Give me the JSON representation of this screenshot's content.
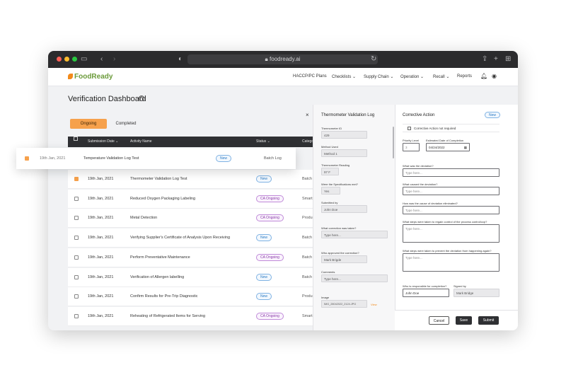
{
  "browser": {
    "url": "foodready.ai"
  },
  "brand": {
    "name": "FoodReady"
  },
  "nav": {
    "items": [
      "HACCP/PC Plans",
      "Checklists ⌄",
      "Supply Chain ⌄",
      "Operation ⌄",
      "Recall ⌄",
      "Reports"
    ]
  },
  "page": {
    "title": "Verification Dashboard",
    "close": "×"
  },
  "tabs": {
    "ongoing": "Ongoing",
    "completed": "Completed"
  },
  "table": {
    "headers": {
      "submission_date": "Submission Date ⌄",
      "activity_name": "Activity Name",
      "status": "Status ⌄",
      "category": "Catego"
    },
    "floating_row": {
      "date": "19th Jan, 2021",
      "activity": "Temperature Validation Log Test",
      "status": "New",
      "category": "Batch Log"
    },
    "rows": [
      {
        "date": "19th Jan, 2021",
        "activity": "Thermometer Validation Log Test",
        "status": "New",
        "category": "Batch"
      },
      {
        "date": "19th Jan, 2021",
        "activity": "Reduced Oxygen Packaging Labeling",
        "status": "CA Ongoing",
        "category": "Smart"
      },
      {
        "date": "19th Jan, 2021",
        "activity": "Metal Detection",
        "status": "CA Ongoing",
        "category": "Produ"
      },
      {
        "date": "19th Jan, 2021",
        "activity": "Verifying Supplier's Certificate of Analysis Upon Receiving",
        "status": "New",
        "category": "Batch"
      },
      {
        "date": "19th Jan, 2021",
        "activity": "Perform Preventative Maintenance",
        "status": "CA Ongoing",
        "category": "Batch"
      },
      {
        "date": "19th Jan, 2021",
        "activity": "Verification of Allergen labelling",
        "status": "New",
        "category": "Batch"
      },
      {
        "date": "19th Jan, 2021",
        "activity": "Confirm Results for Pre-Trip Diagnostic",
        "status": "New",
        "category": "Produ"
      },
      {
        "date": "19th Jan, 2021",
        "activity": "Reheating of Refrigerated Items for Serving",
        "status": "CA Ongoing",
        "category": "Smart"
      }
    ]
  },
  "log_panel": {
    "title": "Thermometer Validation Log",
    "thermometer_id_label": "Thermometer ID",
    "thermometer_id": "429",
    "method_used_label": "Method Used",
    "method_used": "Method 1",
    "reading_label": "Thermometer Reading",
    "reading": "97 F",
    "specs_met_label": "Were the Specifications met?",
    "specs_met": "Yes",
    "submitted_by_label": "Submitted by",
    "submitted_by": "John Doe",
    "correction_label": "What correction was taken?",
    "correction_placeholder": "Type here...",
    "approved_label": "Who approved the correction?",
    "approved_by": "Mark Brigde",
    "comments_label": "Comments",
    "comments_placeholder": "Type here...",
    "image_label": "Image",
    "image_file": "IMG_28042022_2124.JPG",
    "image_link": "View"
  },
  "ca_panel": {
    "title": "Corrective Action",
    "badge": "New",
    "not_required_label": "Corrective Action not required",
    "priority_label": "Priority Level",
    "priority_value": "3",
    "est_date_label": "Estimated Date of Completion",
    "est_date_value": "04/24/2022",
    "q_deviation": "What was the deviation?",
    "q_cause": "What caused the deviation?",
    "q_eliminated": "How was the cause of deviation eliminated?",
    "q_regain": "What steps were taken to regain control of the process control/ccp?",
    "q_prevent": "What steps were taken to prevent the deviation from happening again?",
    "placeholder": "Type here...",
    "responsible_label": "Who is responsible for completion?",
    "responsible_value": "John Doe",
    "signed_label": "Signed by",
    "signed_value": "Mark Bridge"
  },
  "buttons": {
    "cancel": "Cancel",
    "save": "Save",
    "submit": "Submit"
  },
  "colors": {
    "accent": "#f6a14c",
    "dark": "#2f3033",
    "new_badge": "#2d7bc4",
    "ca_badge": "#8a3aa8"
  }
}
